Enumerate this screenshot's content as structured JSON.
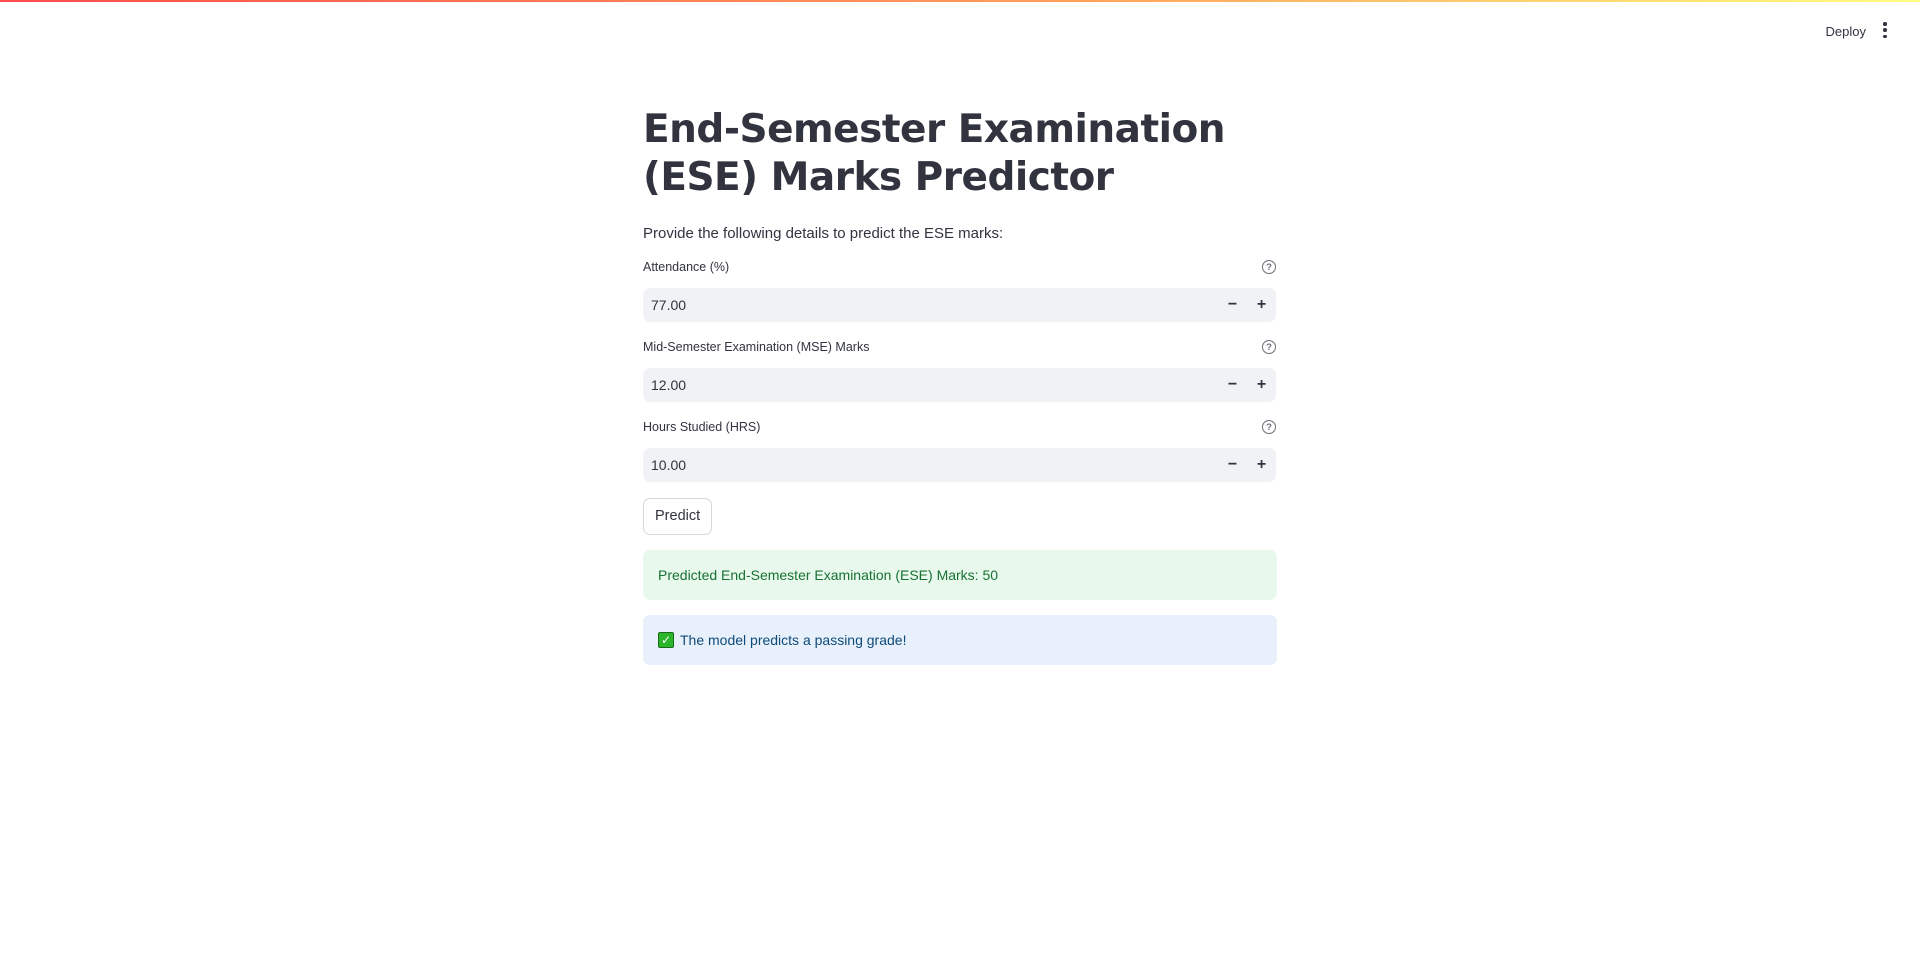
{
  "header": {
    "deploy_label": "Deploy",
    "menu_icon": "more-vertical-icon"
  },
  "main": {
    "title": "End-Semester Examination (ESE) Marks Predictor",
    "subtitle": "Provide the following details to predict the ESE marks:",
    "fields": [
      {
        "label": "Attendance (%)",
        "value": "77.00",
        "help": "?",
        "minus": "−",
        "plus": "+"
      },
      {
        "label": "Mid-Semester Examination (MSE) Marks",
        "value": "12.00",
        "help": "?",
        "minus": "−",
        "plus": "+"
      },
      {
        "label": "Hours Studied (HRS)",
        "value": "10.00",
        "help": "?",
        "minus": "−",
        "plus": "+"
      }
    ],
    "predict_label": "Predict",
    "result_text": "Predicted End-Semester Examination (ESE) Marks: 50",
    "status_icon": "check-mark-icon",
    "status_text": "The model predicts a passing grade!"
  },
  "colors": {
    "accent_gradient_start": "#ff4b4b",
    "accent_gradient_end": "#fffd80",
    "success_bg": "#e8f8ec",
    "success_text": "#177233",
    "info_bg": "#e8f1fb",
    "info_text": "#0d4a7a"
  }
}
